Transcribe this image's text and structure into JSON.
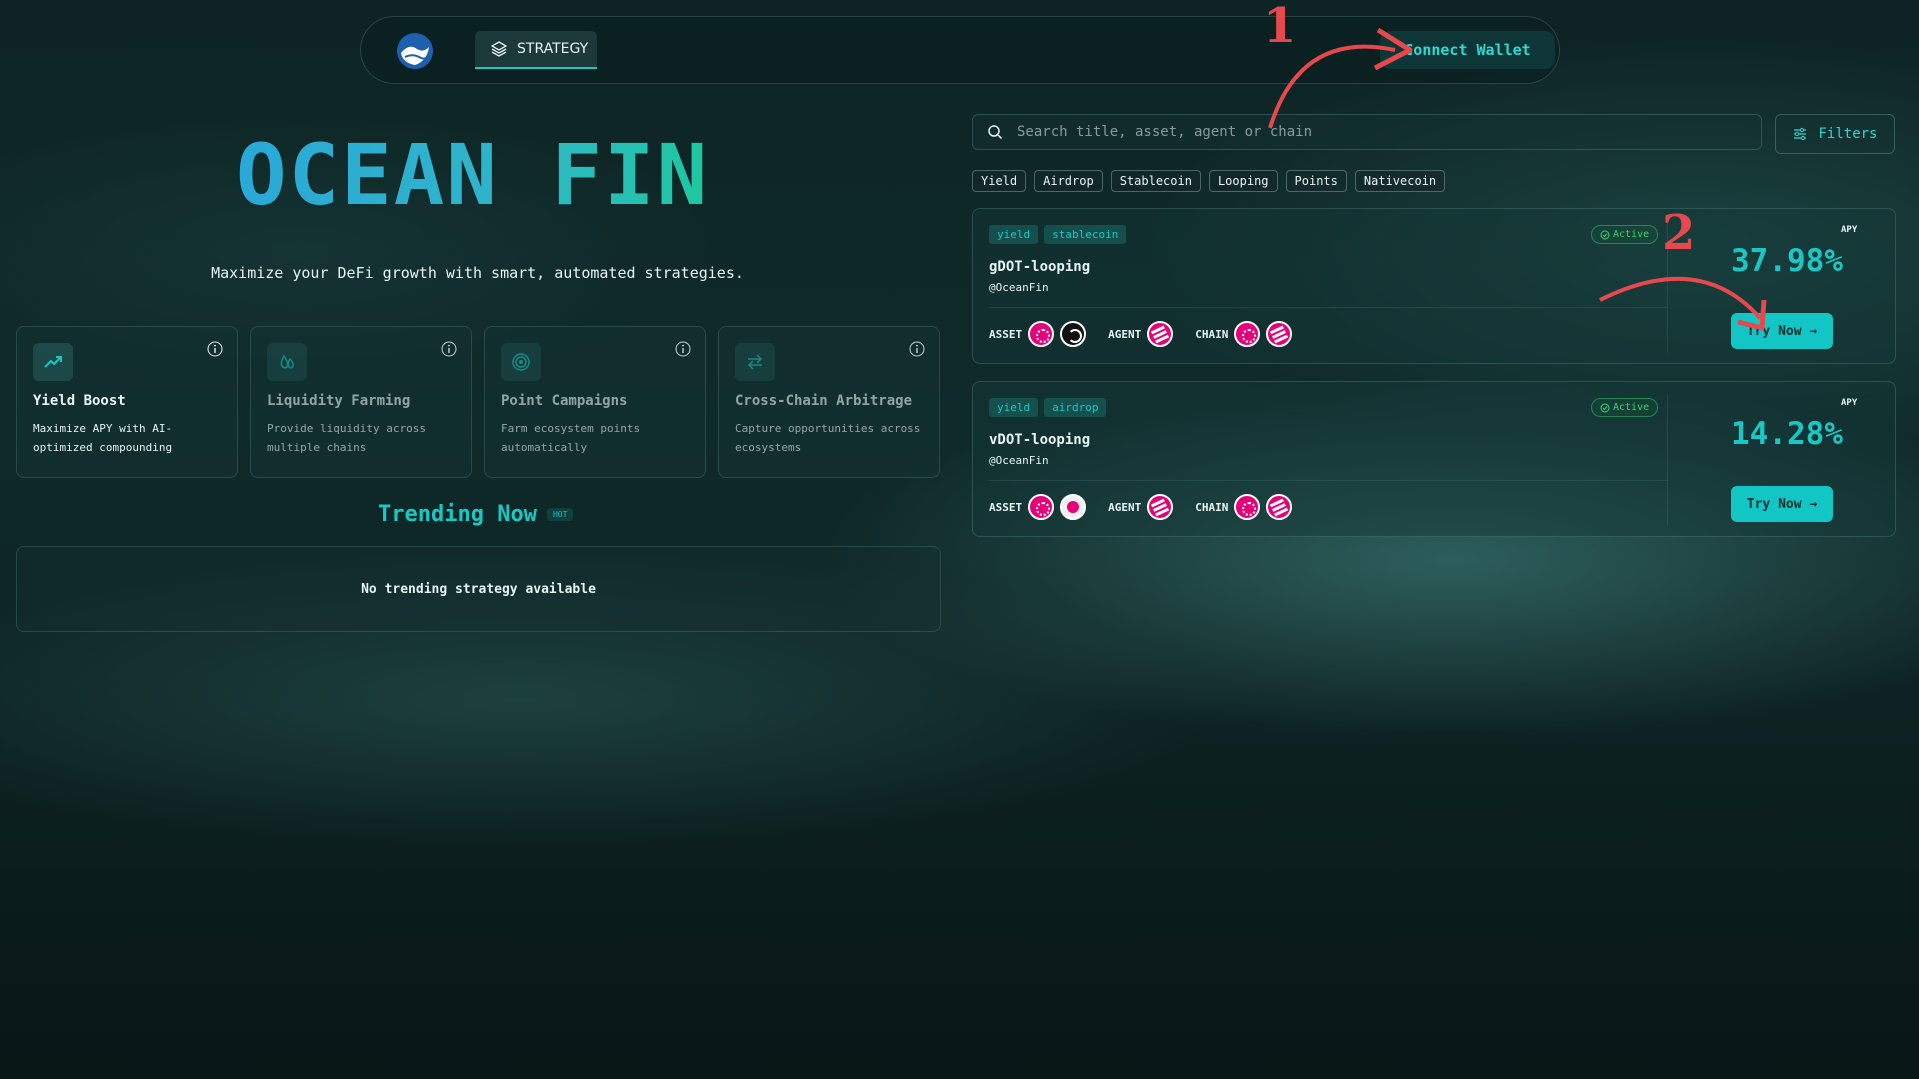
{
  "nav": {
    "tab_label": "STRATEGY",
    "connect_label": "Connect Wallet"
  },
  "hero": {
    "title": "OCEAN FIN",
    "subtitle": "Maximize your DeFi growth with smart, automated strategies."
  },
  "features": [
    {
      "title": "Yield Boost",
      "desc": "Maximize APY with AI-optimized compounding",
      "icon": "trend-up-icon"
    },
    {
      "title": "Liquidity Farming",
      "desc": "Provide liquidity across multiple chains",
      "icon": "drops-icon"
    },
    {
      "title": "Point Campaigns",
      "desc": "Farm ecosystem points automatically",
      "icon": "target-icon"
    },
    {
      "title": "Cross-Chain Arbitrage",
      "desc": "Capture opportunities across ecosystems",
      "icon": "swap-icon"
    }
  ],
  "trending": {
    "title": "Trending Now",
    "badge": "HOT",
    "empty_text": "No trending strategy available"
  },
  "search": {
    "placeholder": "Search title, asset, agent or chain",
    "filters_label": "Filters"
  },
  "chips": [
    "Yield",
    "Airdrop",
    "Stablecoin",
    "Looping",
    "Points",
    "Nativecoin"
  ],
  "strategies": [
    {
      "tags": [
        "yield",
        "stablecoin"
      ],
      "status": "Active",
      "name": "gDOT-looping",
      "author": "@OceanFin",
      "asset_label": "ASSET",
      "agent_label": "AGENT",
      "chain_label": "CHAIN",
      "apy_label": "APY",
      "apy": "37.98%",
      "button": "Try Now →"
    },
    {
      "tags": [
        "yield",
        "airdrop"
      ],
      "status": "Active",
      "name": "vDOT-looping",
      "author": "@OceanFin",
      "asset_label": "ASSET",
      "agent_label": "AGENT",
      "chain_label": "CHAIN",
      "apy_label": "APY",
      "apy": "14.28%",
      "button": "Try Now →"
    }
  ],
  "annotations": {
    "first": "1",
    "second": "2"
  },
  "colors": {
    "accent": "#19c8c4",
    "annotation": "#e5484d",
    "active": "#3ecf7a",
    "coin": "#e6007a"
  }
}
